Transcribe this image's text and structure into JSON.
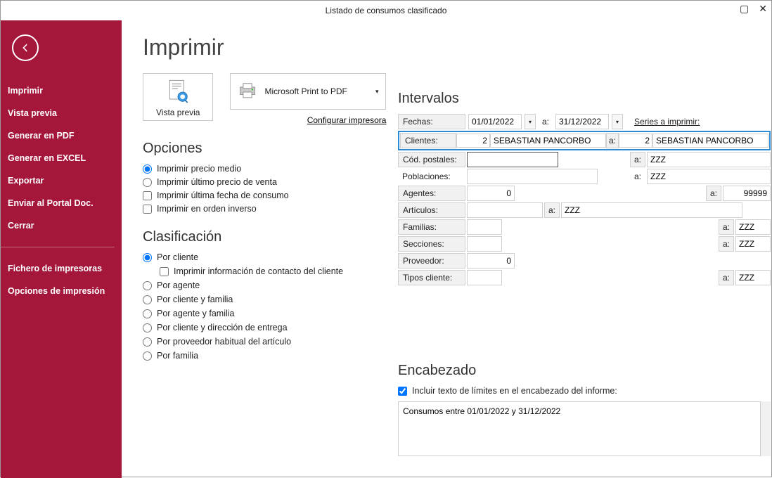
{
  "window": {
    "title": "Listado de consumos clasificado"
  },
  "sidebar": {
    "items": [
      "Imprimir",
      "Vista previa",
      "Generar en PDF",
      "Generar en EXCEL",
      "Exportar",
      "Enviar al Portal Doc.",
      "Cerrar"
    ],
    "items2": [
      "Fichero de impresoras",
      "Opciones de impresión"
    ]
  },
  "page": {
    "title": "Imprimir",
    "preview_label": "Vista previa",
    "printer_name": "Microsoft Print to PDF",
    "config_printer": "Configurar impresora"
  },
  "opciones": {
    "heading": "Opciones",
    "items": [
      "Imprimir precio medio",
      "Imprimir último precio de venta",
      "Imprimir última fecha de consumo",
      "Imprimir en orden inverso"
    ]
  },
  "clasif": {
    "heading": "Clasificación",
    "items": [
      "Por cliente",
      "Por agente",
      "Por cliente y familia",
      "Por agente y familia",
      "Por cliente y dirección de entrega",
      "Por proveedor habitual del artículo",
      "Por familia"
    ],
    "sub": "Imprimir información de contacto del cliente"
  },
  "intervalos": {
    "heading": "Intervalos",
    "labels": {
      "fechas": "Fechas:",
      "clientes": "Clientes:",
      "codpost": "Cód. postales:",
      "poblac": "Poblaciones:",
      "agentes": "Agentes:",
      "articulos": "Artículos:",
      "familias": "Familias:",
      "secciones": "Secciones:",
      "proveedor": "Proveedor:",
      "tiposcli": "Tipos cliente:",
      "a": "a:",
      "series": "Series a imprimir:"
    },
    "fechas": {
      "from": "01/01/2022",
      "to": "31/12/2022"
    },
    "clientes": {
      "from_code": "2",
      "from_name": "SEBASTIAN PANCORBO",
      "to_code": "2",
      "to_name": "SEBASTIAN PANCORBO"
    },
    "codpost": {
      "from": "",
      "to": "ZZZ"
    },
    "poblac": {
      "from": "",
      "to": "ZZZ"
    },
    "agentes": {
      "from": "0",
      "to": "99999"
    },
    "articulos": {
      "from": "",
      "to": "ZZZ"
    },
    "familias": {
      "from": "",
      "to": "ZZZ"
    },
    "secciones": {
      "from": "",
      "to": "ZZZ"
    },
    "proveedor": {
      "from": "0"
    },
    "tiposcli": {
      "from": "",
      "to": "ZZZ"
    }
  },
  "encabezado": {
    "heading": "Encabezado",
    "check": "Incluir texto de límites en el encabezado del informe:",
    "text": "Consumos entre 01/01/2022 y 31/12/2022"
  }
}
